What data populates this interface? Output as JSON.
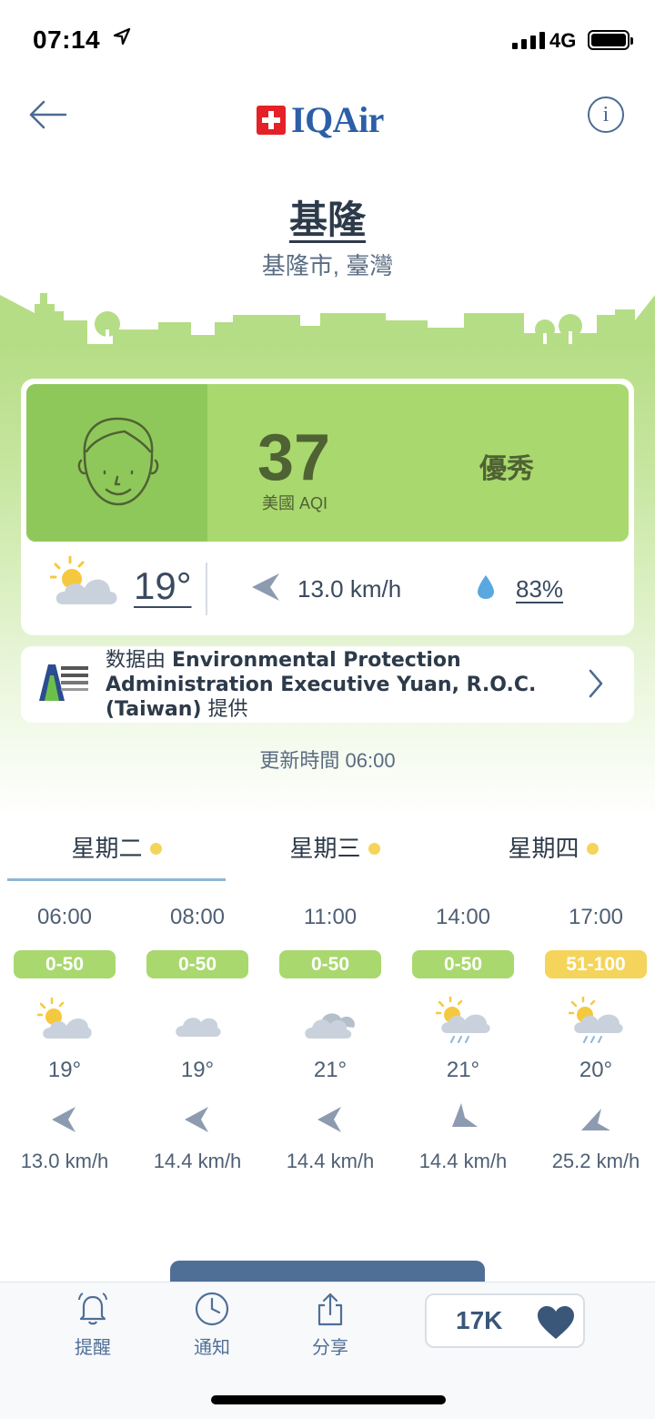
{
  "status_bar": {
    "time": "07:14",
    "network": "4G"
  },
  "header": {
    "logo_text": "IQAir",
    "info_label": "i"
  },
  "location": {
    "city": "基隆",
    "region": "基隆市, 臺灣"
  },
  "aqi": {
    "value": "37",
    "label": "美國 AQI",
    "status": "優秀",
    "color": "#a9d86e"
  },
  "weather": {
    "temperature": "19°",
    "wind": "13.0 km/h",
    "humidity": "83%"
  },
  "source": {
    "prefix": "数据由 ",
    "name": "Environmental Protection Administration Executive Yuan, R.O.C. (Taiwan)",
    "suffix": "提供"
  },
  "updated": "更新時間 06:00",
  "day_tabs": [
    {
      "label": "星期二"
    },
    {
      "label": "星期三"
    },
    {
      "label": "星期四"
    }
  ],
  "hourly": [
    {
      "time": "06:00",
      "aqi_range": "0-50",
      "badge_color": "#a9d86e",
      "icon": "partly-sunny-icon",
      "temp": "19°",
      "wind": "13.0 km/h"
    },
    {
      "time": "08:00",
      "aqi_range": "0-50",
      "badge_color": "#a9d86e",
      "icon": "cloud-icon",
      "temp": "19°",
      "wind": "14.4 km/h"
    },
    {
      "time": "11:00",
      "aqi_range": "0-50",
      "badge_color": "#a9d86e",
      "icon": "cloudy-icon",
      "temp": "21°",
      "wind": "14.4 km/h"
    },
    {
      "time": "14:00",
      "aqi_range": "0-50",
      "badge_color": "#a9d86e",
      "icon": "sun-rain-icon",
      "temp": "21°",
      "wind": "14.4 km/h"
    },
    {
      "time": "17:00",
      "aqi_range": "51-100",
      "badge_color": "#f5d45b",
      "icon": "sun-rain-icon",
      "temp": "20°",
      "wind": "25.2 km/h"
    }
  ],
  "tabbar": {
    "reminder": "提醒",
    "notify": "通知",
    "share": "分享",
    "likes": "17K"
  }
}
